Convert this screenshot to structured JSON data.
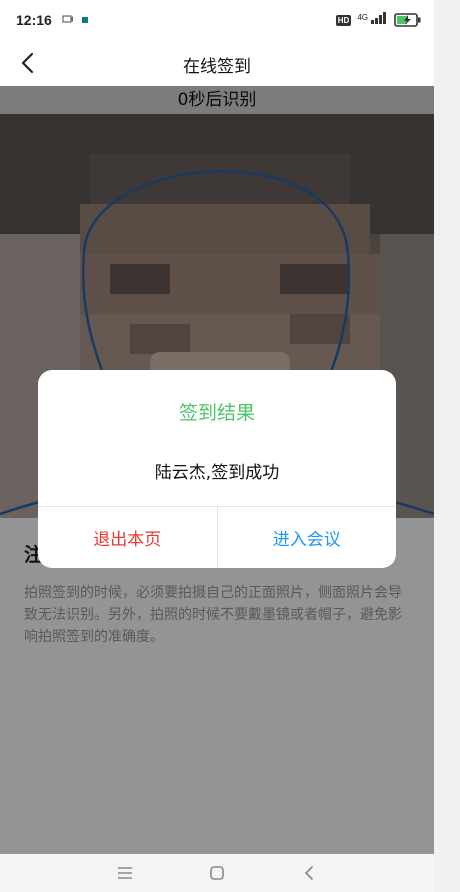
{
  "status_bar": {
    "time": "12:16",
    "network_label": "4G",
    "hd_badge": "HD"
  },
  "nav": {
    "title": "在线签到"
  },
  "camera": {
    "countdown": "0秒后识别"
  },
  "notes": {
    "title": "注",
    "body": "拍照签到的时候，必须要拍摄自己的正面照片，侧面照片会导致无法识别。另外，拍照的时候不要戴墨镜或者帽子，避免影响拍照签到的准确度。"
  },
  "dialog": {
    "title": "签到结果",
    "message": "陆云杰,签到成功",
    "exit_label": "退出本页",
    "enter_label": "进入会议"
  },
  "colors": {
    "success_green": "#4cc46a",
    "exit_red": "#e53935",
    "enter_blue": "#2196f3",
    "outline_blue": "#2a64a8"
  },
  "icons": {
    "back": "chevron-left-icon",
    "menu": "menu-icon",
    "home": "home-square-icon",
    "system_back": "chevron-left-icon",
    "battery": "battery-charging-icon",
    "signal": "signal-icon"
  }
}
